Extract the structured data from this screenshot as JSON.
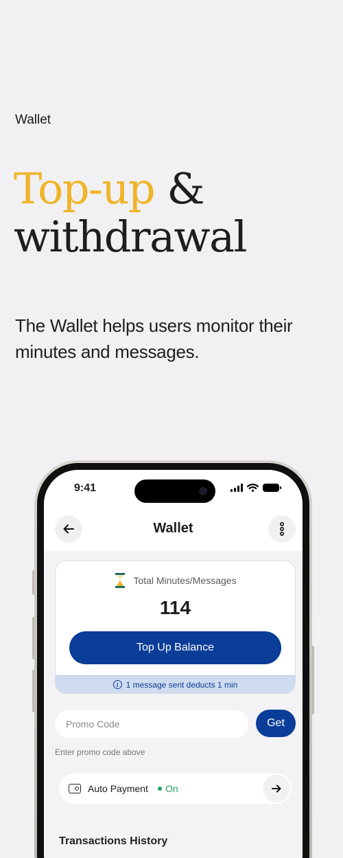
{
  "page": {
    "label": "Wallet",
    "headline_accent": "Top-up",
    "headline_rest": " &",
    "headline_line2": "withdrawal",
    "description": "The Wallet helps users monitor their minutes and messages."
  },
  "colors": {
    "accent_yellow": "#f0b429",
    "brand_blue": "#0a3d98",
    "status_green": "#22a35a"
  },
  "phone": {
    "status_bar": {
      "time": "9:41"
    },
    "header": {
      "title": "Wallet",
      "back_icon": "arrow-left-icon",
      "more_icon": "more-vertical-icon"
    },
    "balance": {
      "title": "Total Minutes/Messages",
      "icon": "hourglass-icon",
      "value": "114",
      "button_label": "Top Up Balance",
      "info_text": "1 message sent deducts 1 min"
    },
    "promo": {
      "placeholder": "Promo Code",
      "button_label": "Get",
      "hint": "Enter promo code above"
    },
    "auto_payment": {
      "label": "Auto Payment",
      "status": "On",
      "icon": "wallet-icon"
    },
    "transactions": {
      "heading": "Transactions History"
    }
  }
}
